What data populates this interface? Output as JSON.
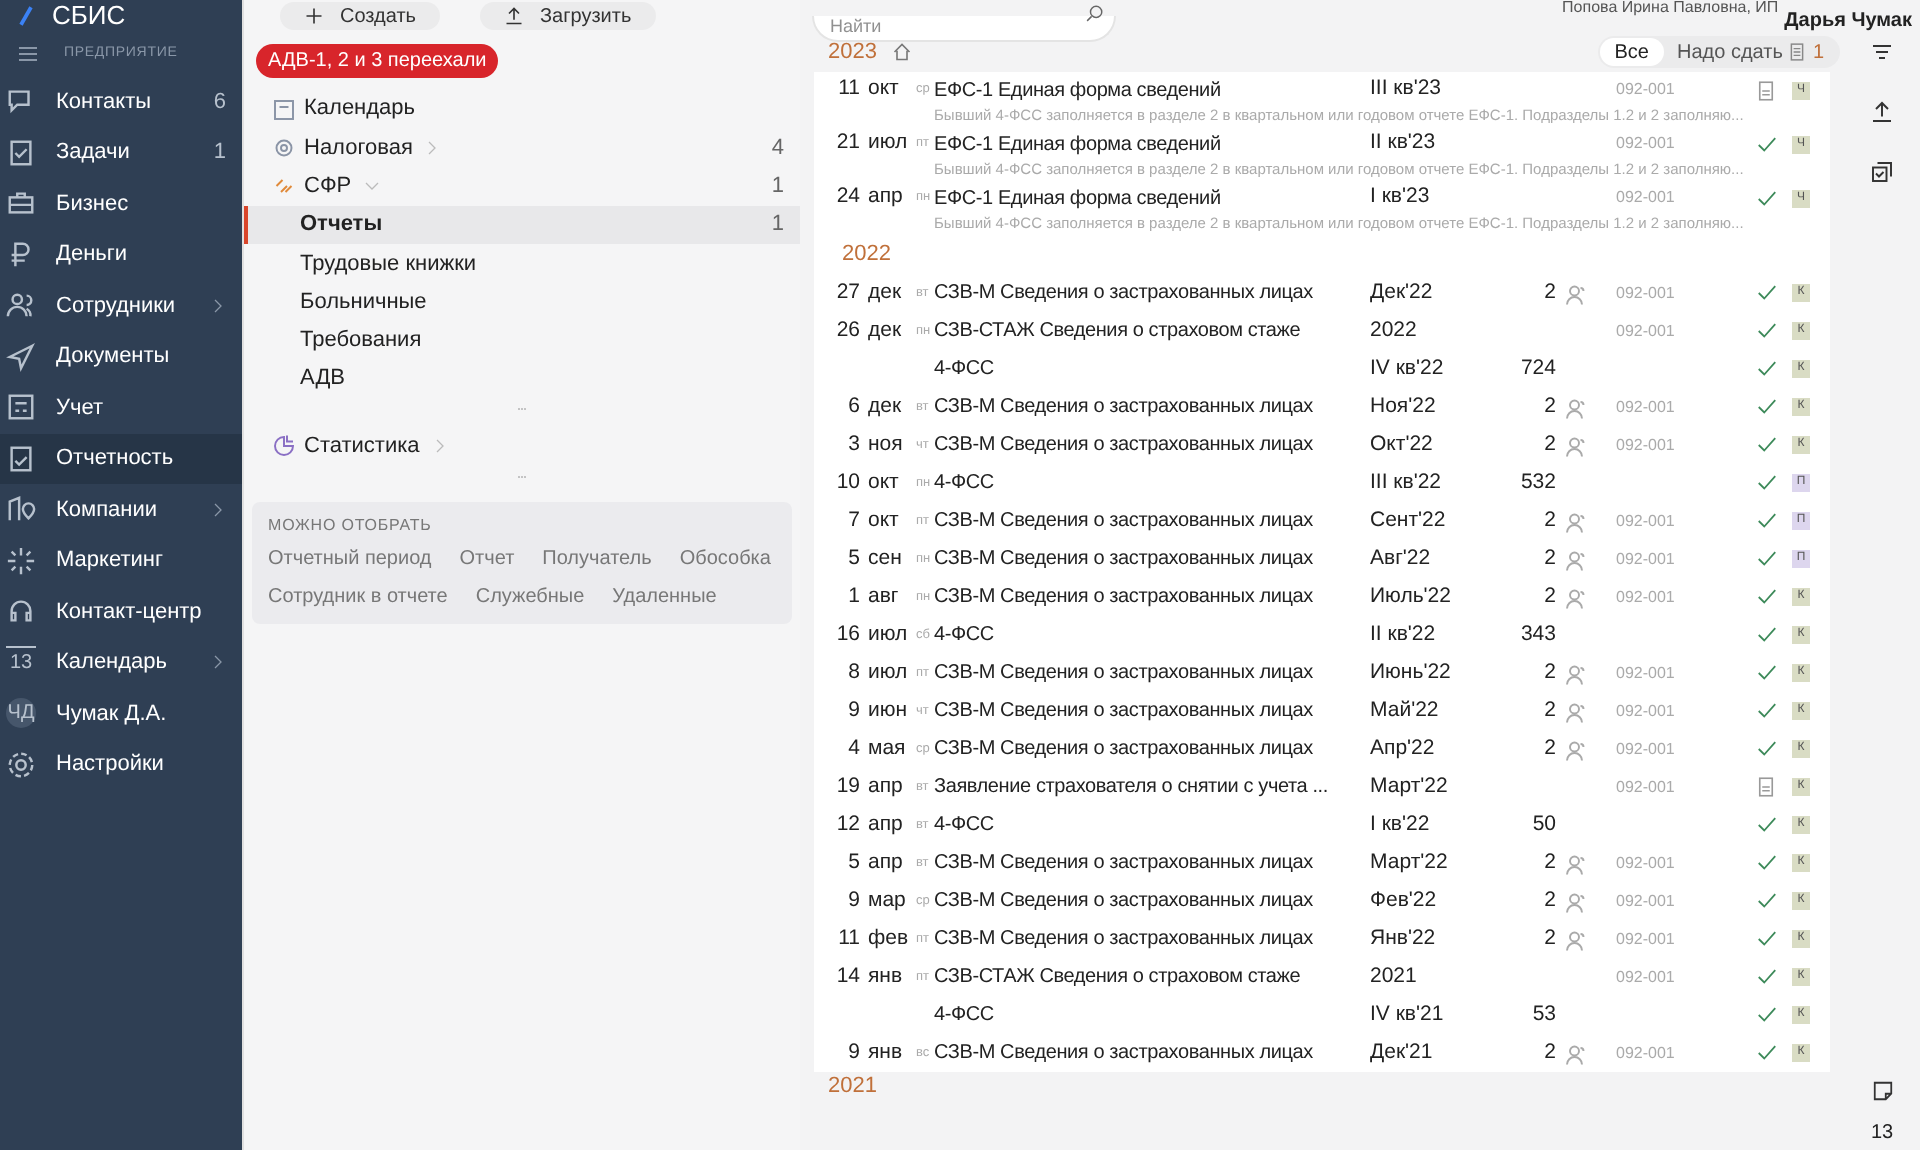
{
  "app": {
    "logo": "СБИС",
    "section": "ПРЕДПРИЯТИЕ"
  },
  "nav": [
    {
      "label": "Контакты",
      "count": "6",
      "selected": false
    },
    {
      "label": "Задачи",
      "count": "1",
      "selected": false
    },
    {
      "label": "Бизнес",
      "selected": false
    },
    {
      "label": "Деньги",
      "selected": false
    },
    {
      "label": "Сотрудники",
      "has_children": true,
      "selected": false
    },
    {
      "label": "Документы",
      "selected": false
    },
    {
      "label": "Учет",
      "selected": false
    },
    {
      "label": "Отчетность",
      "selected": true
    },
    {
      "label": "Компании",
      "has_children": true,
      "selected": false
    },
    {
      "label": "Маркетинг",
      "selected": false
    },
    {
      "label": "Контакт-центр",
      "selected": false
    },
    {
      "label": "Календарь",
      "has_children": true,
      "icon_text": "13",
      "selected": false
    },
    {
      "label": "Чумак Д.А.",
      "icon_text": "ЧД",
      "selected": false
    },
    {
      "label": "Настройки",
      "selected": false
    }
  ],
  "toolbar": {
    "buttons": [
      "Создать",
      "Загрузить"
    ],
    "banner": "АДВ-1, 2 и 3 переехали",
    "search": {
      "placeholder": "Найти"
    },
    "company": "Попова Ирина Павловна, ИП",
    "user": "Дарья Чумак"
  },
  "tree": [
    {
      "label": "Календарь",
      "selected": false
    },
    {
      "label": "Налоговая",
      "count": "4",
      "expanded": false,
      "selected": false
    },
    {
      "label": "СФР",
      "count": "1",
      "expanded": true,
      "selected": false,
      "children": [
        {
          "label": "Отчеты",
          "count": "1",
          "selected": true
        },
        {
          "label": "Трудовые книжки",
          "selected": false
        },
        {
          "label": "Больничные",
          "selected": false
        },
        {
          "label": "Требования",
          "selected": false
        },
        {
          "label": "АДВ",
          "selected": false
        }
      ]
    },
    {
      "label": "Статистика",
      "expanded": false,
      "selected": false
    }
  ],
  "filters": {
    "title": "МОЖНО ОТОБРАТЬ",
    "options": [
      "Отчетный период",
      "Отчет",
      "Получатель",
      "Обособка",
      "Сотрудник в отчете",
      "Служебные",
      "Удаленные"
    ]
  },
  "view_tabs": [
    {
      "label": "Все",
      "selected": true
    },
    {
      "label": "Надо сдать",
      "count": "1",
      "selected": false
    }
  ],
  "groups": [
    {
      "year": "2023",
      "rows": [
        {
          "day": "11",
          "month": "окт",
          "weekday": "ср",
          "title": "ЕФС-1 Единая форма сведений",
          "subtitle": "Бывший 4-ФСС заполняется в разделе 2 в квартальном или годовом отчете ЕФС-1. Подразделы 1.2 и 2 заполняю...",
          "period": "III кв'23",
          "code": "092-001",
          "submitted": false,
          "tag": "Ч",
          "color": "#d9dcc4"
        },
        {
          "day": "21",
          "month": "июл",
          "weekday": "пт",
          "title": "ЕФС-1 Единая форма сведений",
          "subtitle": "Бывший 4-ФСС заполняется в разделе 2 в квартальном или годовом отчете ЕФС-1. Подразделы 1.2 и 2 заполняю...",
          "period": "II кв'23",
          "code": "092-001",
          "submitted": true,
          "tag": "Ч",
          "color": "#d9dcc4"
        },
        {
          "day": "24",
          "month": "апр",
          "weekday": "пн",
          "title": "ЕФС-1 Единая форма сведений",
          "subtitle": "Бывший 4-ФСС заполняется в разделе 2 в квартальном или годовом отчете ЕФС-1. Подразделы 1.2 и 2 заполняю...",
          "period": "I кв'23",
          "code": "092-001",
          "submitted": true,
          "tag": "Ч",
          "color": "#d9dcc4"
        }
      ]
    },
    {
      "year": "2022",
      "rows": [
        {
          "day": "27",
          "month": "дек",
          "weekday": "вт",
          "title": "СЗВ-М Сведения о застрахованных лицах",
          "period": "Дек'22",
          "count": "2",
          "people": true,
          "code": "092-001",
          "submitted": true,
          "tag": "К",
          "color": "#d9dcc4"
        },
        {
          "day": "26",
          "month": "дек",
          "weekday": "пн",
          "title": "СЗВ-СТАЖ Сведения о страховом стаже",
          "period": "2022",
          "code": "092-001",
          "submitted": true,
          "tag": "К",
          "color": "#d9dcc4"
        },
        {
          "title": "4-ФСС",
          "period": "IV кв'22",
          "count": "724",
          "people": false,
          "submitted": true,
          "tag": "К",
          "color": "#d9dcc4"
        },
        {
          "day": "6",
          "month": "дек",
          "weekday": "вт",
          "title": "СЗВ-М Сведения о застрахованных лицах",
          "period": "Ноя'22",
          "count": "2",
          "people": true,
          "code": "092-001",
          "submitted": true,
          "tag": "К",
          "color": "#d9dcc4"
        },
        {
          "day": "3",
          "month": "ноя",
          "weekday": "чт",
          "title": "СЗВ-М Сведения о застрахованных лицах",
          "period": "Окт'22",
          "count": "2",
          "people": true,
          "code": "092-001",
          "submitted": true,
          "tag": "К",
          "color": "#d9dcc4"
        },
        {
          "day": "10",
          "month": "окт",
          "weekday": "пн",
          "title": "4-ФСС",
          "period": "III кв'22",
          "count": "532",
          "people": false,
          "submitted": true,
          "tag": "П",
          "color": "#ddd6ee"
        },
        {
          "day": "7",
          "month": "окт",
          "weekday": "пт",
          "title": "СЗВ-М Сведения о застрахованных лицах",
          "period": "Сент'22",
          "count": "2",
          "people": true,
          "code": "092-001",
          "submitted": true,
          "tag": "П",
          "color": "#ddd6ee"
        },
        {
          "day": "5",
          "month": "сен",
          "weekday": "пн",
          "title": "СЗВ-М Сведения о застрахованных лицах",
          "period": "Авг'22",
          "count": "2",
          "people": true,
          "code": "092-001",
          "submitted": true,
          "tag": "П",
          "color": "#ddd6ee"
        },
        {
          "day": "1",
          "month": "авг",
          "weekday": "пн",
          "title": "СЗВ-М Сведения о застрахованных лицах",
          "period": "Июль'22",
          "count": "2",
          "people": true,
          "code": "092-001",
          "submitted": true,
          "tag": "К",
          "color": "#d9dcc4"
        },
        {
          "day": "16",
          "month": "июл",
          "weekday": "сб",
          "title": "4-ФСС",
          "period": "II кв'22",
          "count": "343",
          "people": false,
          "submitted": true,
          "tag": "К",
          "color": "#d9dcc4"
        },
        {
          "day": "8",
          "month": "июл",
          "weekday": "пт",
          "title": "СЗВ-М Сведения о застрахованных лицах",
          "period": "Июнь'22",
          "count": "2",
          "people": true,
          "code": "092-001",
          "submitted": true,
          "tag": "К",
          "color": "#d9dcc4"
        },
        {
          "day": "9",
          "month": "июн",
          "weekday": "чт",
          "title": "СЗВ-М Сведения о застрахованных лицах",
          "period": "Май'22",
          "count": "2",
          "people": true,
          "code": "092-001",
          "submitted": true,
          "tag": "К",
          "color": "#d9dcc4"
        },
        {
          "day": "4",
          "month": "мая",
          "weekday": "ср",
          "title": "СЗВ-М Сведения о застрахованных лицах",
          "period": "Апр'22",
          "count": "2",
          "people": true,
          "code": "092-001",
          "submitted": true,
          "tag": "К",
          "color": "#d9dcc4"
        },
        {
          "day": "19",
          "month": "апр",
          "weekday": "вт",
          "title": "Заявление страхователя о снятии с учета ...",
          "period": "Март'22",
          "code": "092-001",
          "submitted": false,
          "tag": "К",
          "color": "#d9dcc4"
        },
        {
          "day": "12",
          "month": "апр",
          "weekday": "вт",
          "title": "4-ФСС",
          "period": "I кв'22",
          "count": "50",
          "people": false,
          "submitted": true,
          "tag": "К",
          "color": "#d9dcc4"
        },
        {
          "day": "5",
          "month": "апр",
          "weekday": "вт",
          "title": "СЗВ-М Сведения о застрахованных лицах",
          "period": "Март'22",
          "count": "2",
          "people": true,
          "code": "092-001",
          "submitted": true,
          "tag": "К",
          "color": "#d9dcc4"
        },
        {
          "day": "9",
          "month": "мар",
          "weekday": "ср",
          "title": "СЗВ-М Сведения о застрахованных лицах",
          "period": "Фев'22",
          "count": "2",
          "people": true,
          "code": "092-001",
          "submitted": true,
          "tag": "К",
          "color": "#d9dcc4"
        },
        {
          "day": "11",
          "month": "фев",
          "weekday": "пт",
          "title": "СЗВ-М Сведения о застрахованных лицах",
          "period": "Янв'22",
          "count": "2",
          "people": true,
          "code": "092-001",
          "submitted": true,
          "tag": "К",
          "color": "#d9dcc4"
        },
        {
          "day": "14",
          "month": "янв",
          "weekday": "пт",
          "title": "СЗВ-СТАЖ Сведения о страховом стаже",
          "period": "2021",
          "code": "092-001",
          "submitted": true,
          "tag": "К",
          "color": "#d9dcc4"
        },
        {
          "title": "4-ФСС",
          "period": "IV кв'21",
          "count": "53",
          "people": false,
          "submitted": true,
          "tag": "К",
          "color": "#d9dcc4"
        },
        {
          "day": "9",
          "month": "янв",
          "weekday": "вс",
          "title": "СЗВ-М Сведения о застрахованных лицах",
          "period": "Дек'21",
          "count": "2",
          "people": true,
          "code": "092-001",
          "submitted": true,
          "tag": "К",
          "color": "#d9dcc4"
        }
      ]
    },
    {
      "year": "2021"
    }
  ],
  "side_counter": "13"
}
